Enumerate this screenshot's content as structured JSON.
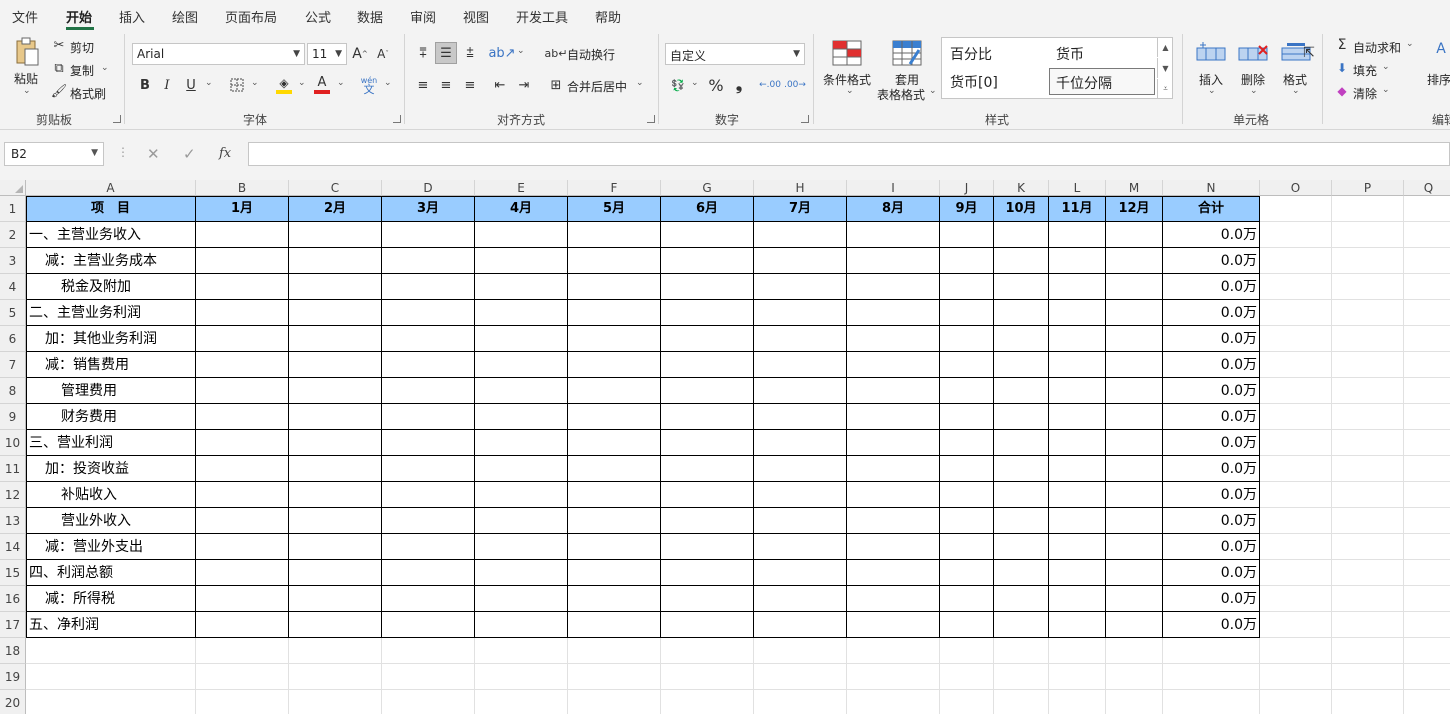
{
  "menu": {
    "tabs": [
      "文件",
      "开始",
      "插入",
      "绘图",
      "页面布局",
      "公式",
      "数据",
      "审阅",
      "视图",
      "开发工具",
      "帮助"
    ],
    "active": "开始"
  },
  "ribbon": {
    "clipboard": {
      "paste": "粘贴",
      "cut": "剪切",
      "copy": "复制",
      "format_painter": "格式刷",
      "label": "剪贴板"
    },
    "font": {
      "name": "Arial",
      "size": "11",
      "label": "字体",
      "bold": "B",
      "italic": "I",
      "underline": "U",
      "phonetic": "wén\n文"
    },
    "alignment": {
      "wrap": "自动换行",
      "merge": "合并后居中",
      "label": "对齐方式"
    },
    "number": {
      "format": "自定义",
      "label": "数字"
    },
    "styles": {
      "conditional": "条件格式",
      "table_format_1": "套用",
      "table_format_2": "表格格式",
      "gallery": [
        "百分比",
        "货币",
        "货币[0]",
        "千位分隔"
      ],
      "label": "样式"
    },
    "cells": {
      "insert": "插入",
      "delete": "删除",
      "format": "格式",
      "label": "单元格"
    },
    "editing": {
      "autosum": "自动求和",
      "fill": "填充",
      "clear": "清除",
      "sort": "排序",
      "label": "编辑"
    }
  },
  "formula_bar": {
    "name_box": "B2",
    "cancel": "✕",
    "enter": "✓",
    "fx": "fx",
    "value": ""
  },
  "sheet": {
    "columns": [
      "A",
      "B",
      "C",
      "D",
      "E",
      "F",
      "G",
      "H",
      "I",
      "J",
      "K",
      "L",
      "M",
      "N",
      "O",
      "P",
      "Q"
    ],
    "rows": [
      "1",
      "2",
      "3",
      "4",
      "5",
      "6",
      "7",
      "8",
      "9",
      "10",
      "11",
      "12",
      "13",
      "14",
      "15",
      "16",
      "17",
      "18",
      "19",
      "20"
    ],
    "header_row": [
      "项　目",
      "1月",
      "2月",
      "3月",
      "4月",
      "5月",
      "6月",
      "7月",
      "8月",
      "9月",
      "10月",
      "11月",
      "12月",
      "合计"
    ],
    "items": [
      "一、主营业务收入",
      "减：主营业务成本",
      "税金及附加",
      "二、主营业务利润",
      "加：其他业务利润",
      "减：销售费用",
      "管理费用",
      "财务费用",
      "三、营业利润",
      "加：投资收益",
      "补贴收入",
      "营业外收入",
      "减：营业外支出",
      "四、利润总额",
      "减：所得税",
      "五、净利润"
    ],
    "totals": [
      "0.0万",
      "0.0万",
      "0.0万",
      "0.0万",
      "0.0万",
      "0.0万",
      "0.0万",
      "0.0万",
      "0.0万",
      "0.0万",
      "0.0万",
      "0.0万",
      "0.0万",
      "0.0万",
      "0.0万",
      "0.0万"
    ],
    "header_fill": "#99ccff"
  },
  "colors": {
    "accent": "#217346",
    "red": "#e02020",
    "yellow": "#ffd800"
  }
}
